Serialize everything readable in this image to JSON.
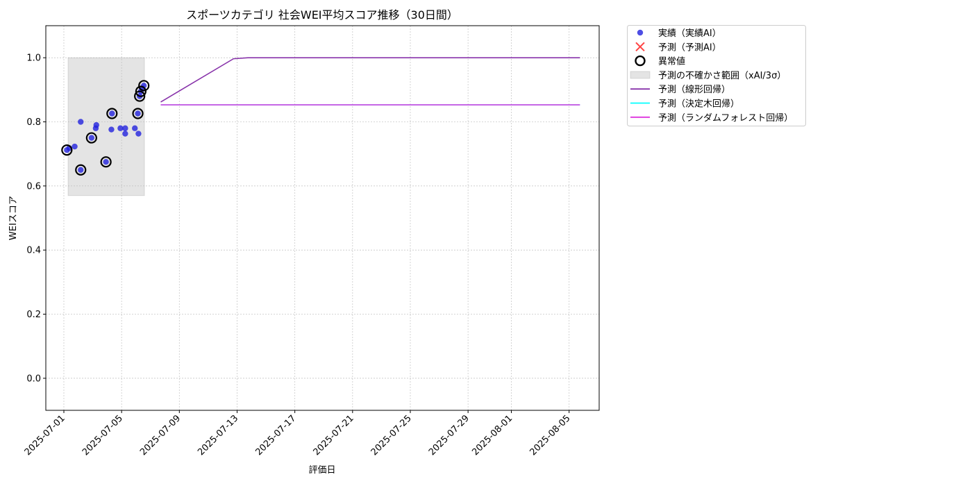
{
  "chart_data": {
    "type": "scatter",
    "title": "スポーツカテゴリ 社会WEI平均スコア推移（30日間）",
    "xlabel": "評価日",
    "ylabel": "WEIスコア",
    "xlim": [
      "2025-06-29T18:00",
      "2025-08-07T02:00"
    ],
    "ylim": [
      -0.1,
      1.1
    ],
    "yticks": [
      0.0,
      0.2,
      0.4,
      0.6,
      0.8,
      1.0
    ],
    "ytick_labels": [
      "0.0",
      "0.2",
      "0.4",
      "0.6",
      "0.8",
      "1.0"
    ],
    "xticks": [
      "2025-07-01",
      "2025-07-05",
      "2025-07-09",
      "2025-07-13",
      "2025-07-17",
      "2025-07-21",
      "2025-07-25",
      "2025-07-29",
      "2025-08-01",
      "2025-08-05"
    ],
    "grid": true,
    "legend_position": "outside-top-right",
    "band": {
      "name": "予測の不確かさ範囲（xAI/3σ）",
      "x": [
        "2025-07-01T07:00",
        "2025-07-06T14:00"
      ],
      "y": [
        0.57,
        1.0
      ],
      "color": "#bbbbbb"
    },
    "actual": {
      "name": "実績（実績AI）",
      "color": "#2222dd",
      "points": [
        [
          "2025-07-01T05:00",
          0.712
        ],
        [
          "2025-07-01T09:00",
          0.718
        ],
        [
          "2025-07-01T18:00",
          0.723
        ],
        [
          "2025-07-02T04:00",
          0.8
        ],
        [
          "2025-07-02T04:00",
          0.65
        ],
        [
          "2025-07-02T22:00",
          0.75
        ],
        [
          "2025-07-03T05:00",
          0.78
        ],
        [
          "2025-07-03T06:00",
          0.79
        ],
        [
          "2025-07-03T22:00",
          0.675
        ],
        [
          "2025-07-04T07:00",
          0.776
        ],
        [
          "2025-07-04T08:00",
          0.826
        ],
        [
          "2025-07-04T22:00",
          0.78
        ],
        [
          "2025-07-05T06:00",
          0.78
        ],
        [
          "2025-07-05T06:00",
          0.763
        ],
        [
          "2025-07-05T22:00",
          0.78
        ],
        [
          "2025-07-06T04:00",
          0.763
        ],
        [
          "2025-07-06T03:00",
          0.826
        ],
        [
          "2025-07-06T06:00",
          0.88
        ],
        [
          "2025-07-06T08:00",
          0.895
        ],
        [
          "2025-07-06T10:00",
          0.905
        ],
        [
          "2025-07-06T13:00",
          0.913
        ]
      ]
    },
    "anomalies": {
      "name": "異常値",
      "points": [
        [
          "2025-07-01T05:00",
          0.712
        ],
        [
          "2025-07-02T04:00",
          0.65
        ],
        [
          "2025-07-02T22:00",
          0.75
        ],
        [
          "2025-07-03T22:00",
          0.675
        ],
        [
          "2025-07-04T08:00",
          0.826
        ],
        [
          "2025-07-06T03:00",
          0.826
        ],
        [
          "2025-07-06T06:00",
          0.88
        ],
        [
          "2025-07-06T08:00",
          0.895
        ],
        [
          "2025-07-06T13:00",
          0.913
        ]
      ]
    },
    "series": [
      {
        "name": "予測（予測AI）",
        "color": "#ff4444",
        "marker": "x",
        "points": []
      },
      {
        "name": "予測（線形回帰）",
        "color": "#8833aa",
        "points": [
          [
            "2025-07-07T17:00",
            0.862
          ],
          [
            "2025-07-12T18:00",
            0.997
          ],
          [
            "2025-07-13T18:00",
            1.0
          ],
          [
            "2025-08-05T18:00",
            1.0
          ]
        ]
      },
      {
        "name": "予測（決定木回帰）",
        "color": "#00ffff",
        "points": [
          [
            "2025-07-07T17:00",
            0.853
          ],
          [
            "2025-08-05T18:00",
            0.853
          ]
        ]
      },
      {
        "name": "予測（ランダムフォレスト回帰）",
        "color": "#dd33dd",
        "points": [
          [
            "2025-07-07T17:00",
            0.853
          ],
          [
            "2025-08-05T18:00",
            0.853
          ]
        ]
      }
    ]
  }
}
